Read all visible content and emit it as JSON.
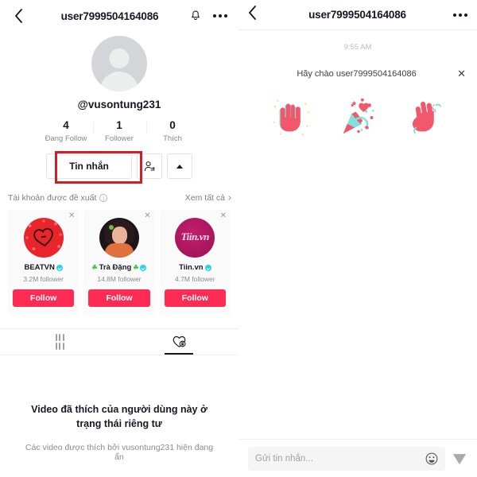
{
  "profile": {
    "header": {
      "back_icon": "chevron-left-icon",
      "title": "user7999504164086",
      "bell_icon": "bell-icon",
      "more_icon": "more-dots-icon"
    },
    "avatar_icon": "default-avatar-icon",
    "handle": "@vusontung231",
    "stats": [
      {
        "num": "4",
        "label": "Đang Follow"
      },
      {
        "num": "1",
        "label": "Follower"
      },
      {
        "num": "0",
        "label": "Thích"
      }
    ],
    "actions": {
      "message_label": "Tin nhắn",
      "add_friend_icon": "add-user-icon",
      "expand_icon": "caret-up-icon"
    },
    "annotation": {
      "color": "#cf1f26",
      "target": "Tin nhắn"
    },
    "suggested": {
      "title": "Tài khoản được đề xuất",
      "info_icon": "info-circle-icon",
      "see_all": "Xem tất cả",
      "chevron_icon": "chevron-right-icon",
      "cards": [
        {
          "name": "BEATVN",
          "followers": "3.2M follower",
          "follow_label": "Follow",
          "verified": true,
          "prefix_emoji": "",
          "suffix_emoji": "",
          "close_icon": "close-icon",
          "avatar_style": "av-beat"
        },
        {
          "name": "Trà Đặng",
          "followers": "14.8M follower",
          "follow_label": "Follow",
          "verified": true,
          "prefix_emoji": "☘",
          "suffix_emoji": "☘",
          "close_icon": "close-icon",
          "avatar_style": "av-tra"
        },
        {
          "name": "Tiin.vn",
          "followers": "4.7M follower",
          "follow_label": "Follow",
          "verified": true,
          "prefix_emoji": "",
          "suffix_emoji": "",
          "close_icon": "close-icon",
          "avatar_style": "av-tiin",
          "avatar_text": "Tiin.vn"
        }
      ]
    },
    "tabs": [
      {
        "name": "videos-tab",
        "icon": "grid-icon",
        "active": false
      },
      {
        "name": "liked-tab",
        "icon": "heart-lock-icon",
        "active": true
      }
    ],
    "empty_state": {
      "heading": "Video đã thích của người dùng này ở trạng thái riêng tư",
      "subtext": "Các video được thích bởi vusontung231 hiện đang ẩn"
    }
  },
  "chat": {
    "header": {
      "back_icon": "chevron-left-icon",
      "title": "user7999504164086",
      "more_icon": "more-dots-icon"
    },
    "timestamp": "9:55 AM",
    "prompt": {
      "text": "Hãy chào user7999504164086",
      "close_icon": "close-icon"
    },
    "stickers": [
      {
        "name": "waving-hand-sticker"
      },
      {
        "name": "party-popper-heart-sticker"
      },
      {
        "name": "raised-hand-sticker"
      }
    ],
    "composer": {
      "placeholder": "Gửi tin nhắn...",
      "emoji_icon": "emoji-smiley-icon",
      "send_icon": "send-paper-plane-icon"
    }
  },
  "colors": {
    "accent": "#fe2c55",
    "verified": "#20d5ec",
    "annotation": "#cf1f26",
    "text": "#161823",
    "muted": "#8a8b8f"
  }
}
